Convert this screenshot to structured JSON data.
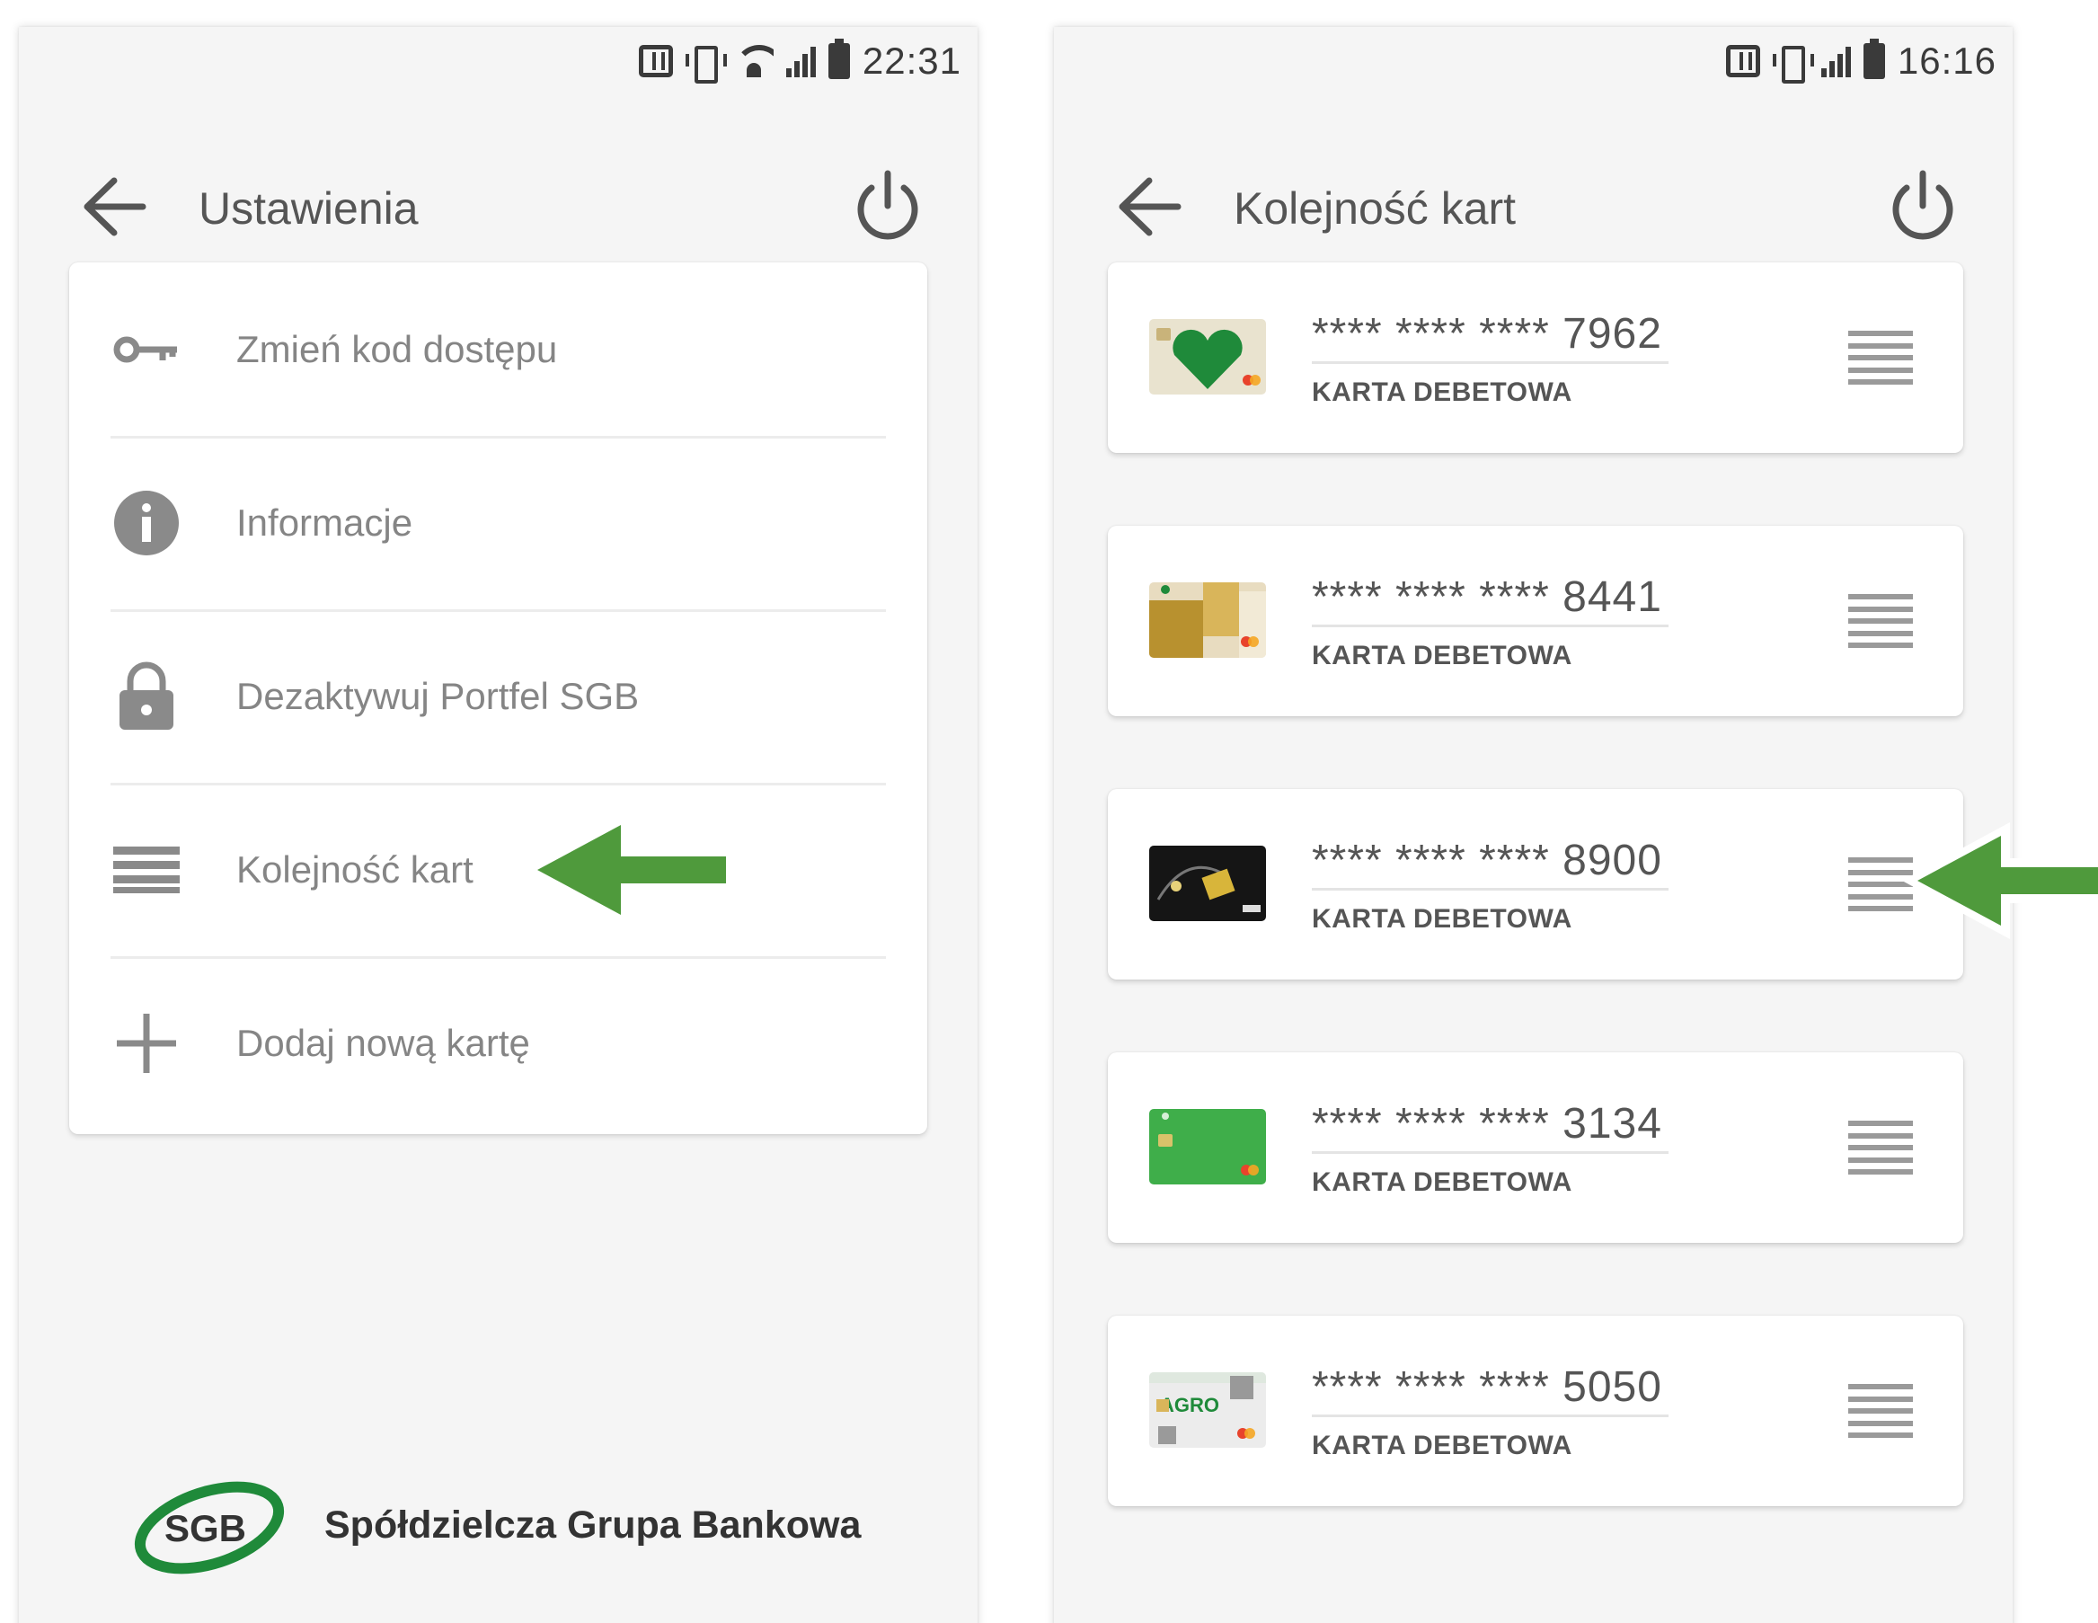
{
  "left_screen": {
    "status_bar": {
      "time": "22:31"
    },
    "app_bar": {
      "title": "Ustawienia"
    },
    "menu_items": [
      {
        "label": "Zmień kod dostępu",
        "icon": "key-icon"
      },
      {
        "label": "Informacje",
        "icon": "info-icon"
      },
      {
        "label": "Dezaktywuj Portfel SGB",
        "icon": "lock-icon"
      },
      {
        "label": "Kolejność kart",
        "icon": "menu-lines-icon"
      },
      {
        "label": "Dodaj nową kartę",
        "icon": "plus-icon"
      }
    ],
    "logo": {
      "mark": "SGB",
      "name": "Spółdzielcza Grupa Bankowa"
    }
  },
  "right_screen": {
    "status_bar": {
      "time": "16:16"
    },
    "app_bar": {
      "title": "Kolejność kart"
    },
    "cards": [
      {
        "number": "**** **** **** 7962",
        "type": "KARTA DEBETOWA",
        "art": "heart-card"
      },
      {
        "number": "**** **** **** 8441",
        "type": "KARTA DEBETOWA",
        "art": "gold-card"
      },
      {
        "number": "**** **** **** 8900",
        "type": "KARTA DEBETOWA",
        "art": "black-visa-card"
      },
      {
        "number": "**** **** **** 3134",
        "type": "KARTA DEBETOWA",
        "art": "green-card"
      },
      {
        "number": "**** **** **** 5050",
        "type": "KARTA DEBETOWA",
        "art": "agro-card"
      }
    ]
  },
  "colors": {
    "brand_green": "#1f8a3a",
    "arrow_green": "#4f9a3c",
    "background": "#f5f5f5",
    "text_gray": "#858585"
  }
}
